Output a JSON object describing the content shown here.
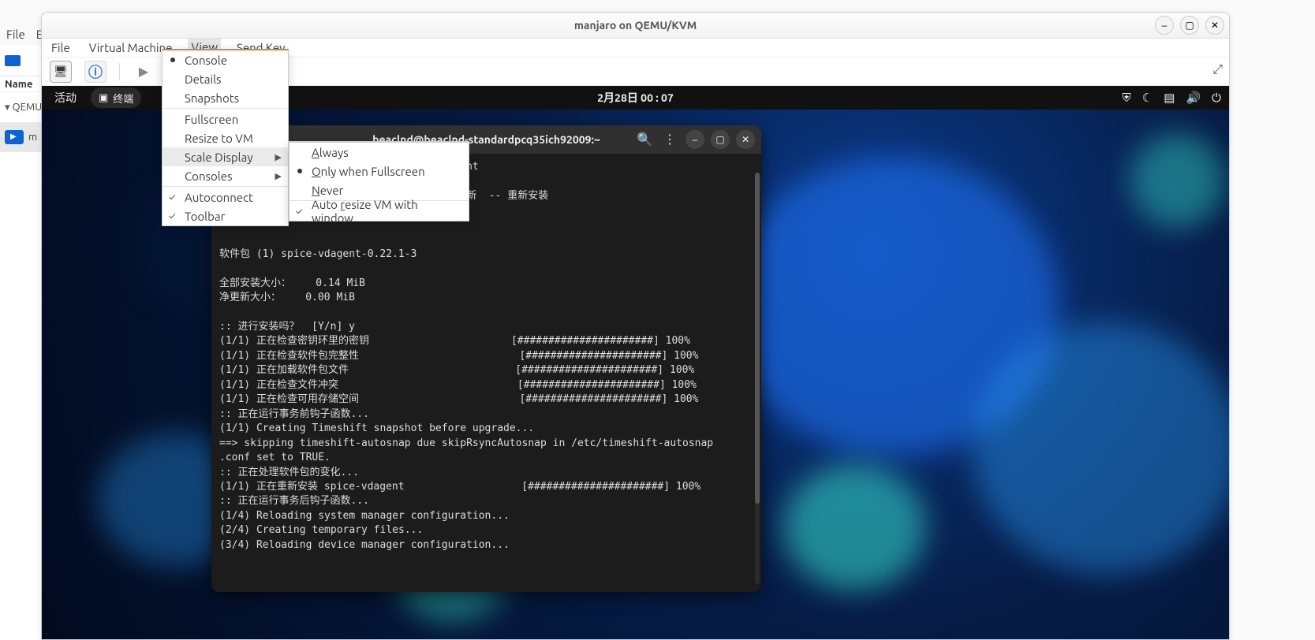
{
  "host": {
    "menubar": [
      "File",
      "E"
    ],
    "col_header": "Name",
    "qemu_item": "QEMU/",
    "selected_vm": "m"
  },
  "window": {
    "title": "manjaro on QEMU/KVM",
    "menubar": {
      "file": "File",
      "virtual_machine": "Virtual Machine",
      "view": "View",
      "send_key": "Send Key"
    },
    "view_menu": {
      "console": "Console",
      "details": "Details",
      "snapshots": "Snapshots",
      "fullscreen": "Fullscreen",
      "resize": "Resize to VM",
      "scale": "Scale Display",
      "consoles": "Consoles",
      "autoconnect": "Autoconnect",
      "toolbar": "Toolbar"
    },
    "scale_submenu": {
      "always": "Always",
      "only_fullscreen": "Only when Fullscreen",
      "never": "Never",
      "auto_resize": "Auto resize VM with window"
    }
  },
  "guest": {
    "topbar": {
      "activities": "活动",
      "terminal_label": "终端",
      "clock": "2月28日  00 : 07"
    },
    "terminal": {
      "title": "beaclnd@beaclnd-standardpcq35ich92009:~",
      "check": "✓",
      "lines": [
        "                                        nt",
        "",
        "                                        新  -- 重新安装",
        "",
        "",
        "",
        "软件包 (1) spice-vdagent-0.22.1-3",
        "",
        "全部安装大小：    0.14 MiB",
        "净更新大小：    0.00 MiB",
        "",
        ":: 进行安装吗？  [Y/n] y",
        "(1/1) 正在检查密钥环里的密钥                       [######################] 100%",
        "(1/1) 正在检查软件包完整性                          [######################] 100%",
        "(1/1) 正在加载软件包文件                           [######################] 100%",
        "(1/1) 正在检查文件冲突                             [######################] 100%",
        "(1/1) 正在检查可用存储空间                          [######################] 100%",
        ":: 正在运行事务前钩子函数...",
        "(1/1) Creating Timeshift snapshot before upgrade...",
        "==> skipping timeshift-autosnap due skipRsyncAutosnap in /etc/timeshift-autosnap",
        ".conf set to TRUE.",
        ":: 正在处理软件包的变化...",
        "(1/1) 正在重新安装 spice-vdagent                   [######################] 100%",
        ":: 正在运行事务后钩子函数...",
        "(1/4) Reloading system manager configuration...",
        "(2/4) Creating temporary files...",
        "(3/4) Reloading device manager configuration..."
      ]
    }
  }
}
